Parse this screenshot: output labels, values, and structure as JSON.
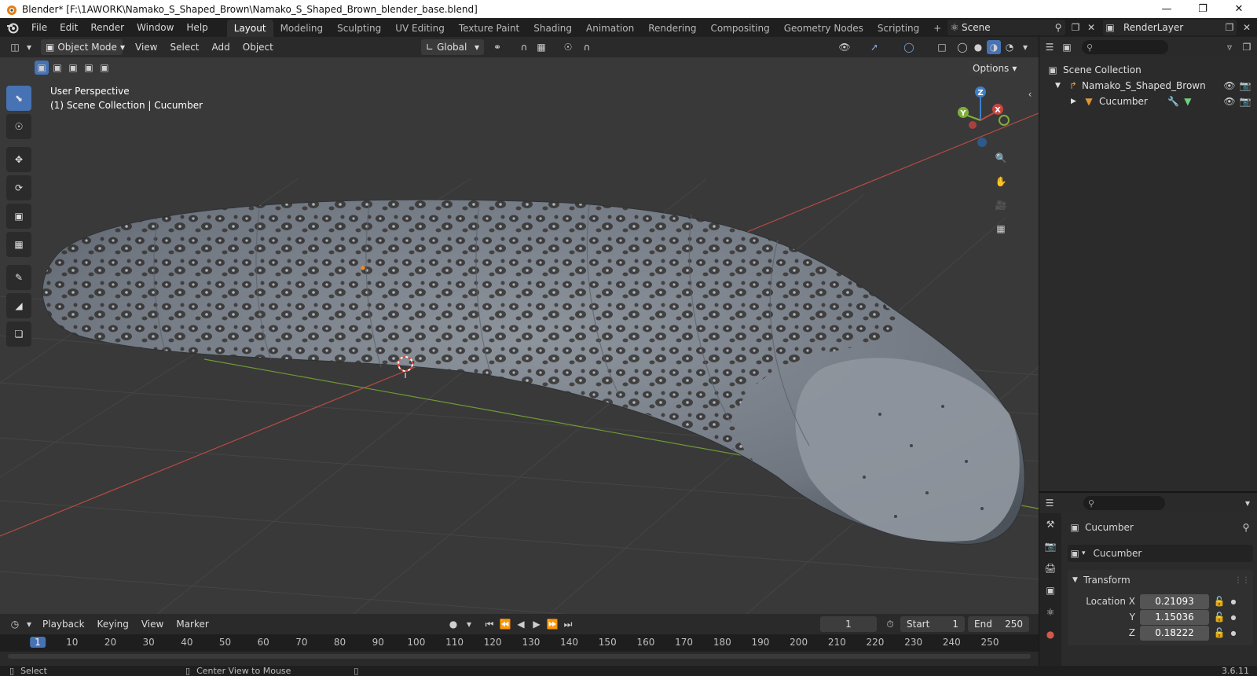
{
  "window": {
    "title": "Blender* [F:\\1AWORK\\Namako_S_Shaped_Brown\\Namako_S_Shaped_Brown_blender_base.blend]",
    "controls": [
      "minimize",
      "maximize",
      "close"
    ]
  },
  "topbar": {
    "menus": [
      "File",
      "Edit",
      "Render",
      "Window",
      "Help"
    ],
    "workspaces": [
      "Layout",
      "Modeling",
      "Sculpting",
      "UV Editing",
      "Texture Paint",
      "Shading",
      "Animation",
      "Rendering",
      "Compositing",
      "Geometry Nodes",
      "Scripting"
    ],
    "active_workspace": "Layout",
    "scene": "Scene",
    "view_layer": "RenderLayer"
  },
  "viewport": {
    "mode": "Object Mode",
    "menus": [
      "View",
      "Select",
      "Add",
      "Object"
    ],
    "transform_orientation": "Global",
    "options_label": "Options",
    "info_line1": "User Perspective",
    "info_line2": "(1) Scene Collection | Cucumber",
    "gizmo_axes": [
      "X",
      "Y",
      "Z"
    ],
    "colors": {
      "background": "#393939",
      "x_axis": "#c8443f",
      "y_axis": "#7fae3a",
      "z_axis": "#3d7fc8",
      "accent": "#4772b3"
    }
  },
  "outliner": {
    "root": "Scene Collection",
    "collection": "Namako_S_Shaped_Brown",
    "object": "Cucumber"
  },
  "properties": {
    "object_name": "Cucumber",
    "data_name": "Cucumber",
    "panel": "Transform",
    "location_label": "Location X",
    "y_label": "Y",
    "z_label": "Z",
    "location": [
      "0.21093",
      "1.15036",
      "0.18222"
    ]
  },
  "timeline": {
    "menus": [
      "Playback",
      "Keying",
      "View",
      "Marker"
    ],
    "current_frame": "1",
    "start_label": "Start",
    "start": "1",
    "end_label": "End",
    "end": "250",
    "ruler_ticks": [
      "1",
      "10",
      "20",
      "30",
      "40",
      "50",
      "60",
      "70",
      "80",
      "90",
      "100",
      "110",
      "120",
      "130",
      "140",
      "150",
      "160",
      "170",
      "180",
      "190",
      "200",
      "210",
      "220",
      "230",
      "240",
      "250"
    ]
  },
  "statusbar": {
    "select": "Select",
    "center_view": "Center View to Mouse",
    "version": "3.6.11"
  }
}
